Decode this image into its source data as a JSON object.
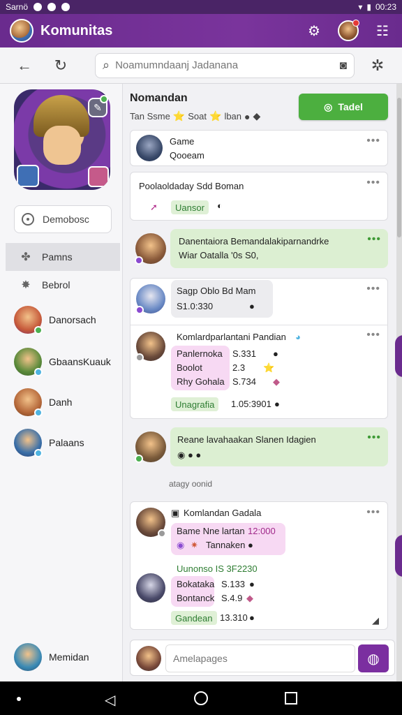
{
  "status_bar": {
    "carrier": "Sarnö",
    "time": "00:23"
  },
  "app": {
    "title": "Komunitas"
  },
  "search": {
    "placeholder": "Noamumndaanj Jadanana"
  },
  "sidebar": {
    "dropdown_label": "Demobosc",
    "nav": [
      {
        "label": "Pamns",
        "icon": "puzzle-icon",
        "active": true
      },
      {
        "label": "Bebrol",
        "icon": "gear-badge-icon",
        "active": false
      }
    ],
    "friends": [
      {
        "name": "Danorsach",
        "color": "#c65a3a",
        "status": "#4caf50"
      },
      {
        "name": "GbaansKuauk",
        "color": "#5a8a3a",
        "status": "#4fb3e0"
      },
      {
        "name": "Danh",
        "color": "#b5683a",
        "status": "#4fb3e0"
      },
      {
        "name": "Palaans",
        "color": "#3a6fa8",
        "status": "#4fb3e0"
      }
    ],
    "self": {
      "name": "Memidan"
    }
  },
  "channel": {
    "title": "Nomandan",
    "meta": [
      "Tan Ssme",
      "Soat",
      "lban"
    ],
    "join_label": "Tadel"
  },
  "posts": {
    "p1": {
      "title": "Game",
      "sub": "Qooeam"
    },
    "p2": {
      "title": "Poolaoldaday Sdd Boman",
      "tag": "Uansor"
    },
    "p3": {
      "line1": "Danentaiora Bemandalakiparnandrke",
      "line2": "Wiar Oatalla '0s S0,"
    },
    "p4": {
      "title": "Sagp Oblo Bd Mam",
      "sub": "S1.0:330"
    },
    "p5": {
      "title": "Komlardparlantani Pandian",
      "items": [
        {
          "label": "Panlernoka",
          "value": "S.331"
        },
        {
          "label": "Boolot",
          "value": "2.3"
        },
        {
          "label": "Rhy Gohala",
          "value": "S.734"
        }
      ],
      "tag": "Unagrafia",
      "tag_value": "1.05:3901"
    },
    "p6": {
      "title": "Reane lavahaakan Slanen Idagien"
    },
    "divider": "atagy oonid",
    "p7": {
      "title": "Komlandan Gadala",
      "line1": "Bame Nne lartan",
      "line1_value": "12:000",
      "line2": "Tannaken",
      "section": "Uunonso IS 3F2230",
      "items": [
        {
          "label": "Bokataka",
          "value": "S.133"
        },
        {
          "label": "Bontanck",
          "value": "S.4.9"
        }
      ],
      "tag": "Gandean",
      "tag_value": "13.310"
    }
  },
  "composer": {
    "placeholder": "Amelapages"
  },
  "colors": {
    "brand": "#6a2b8e",
    "accent_green": "#4caf3f",
    "pill_pink": "#f5d2f3",
    "pill_green": "#dff0d6"
  }
}
